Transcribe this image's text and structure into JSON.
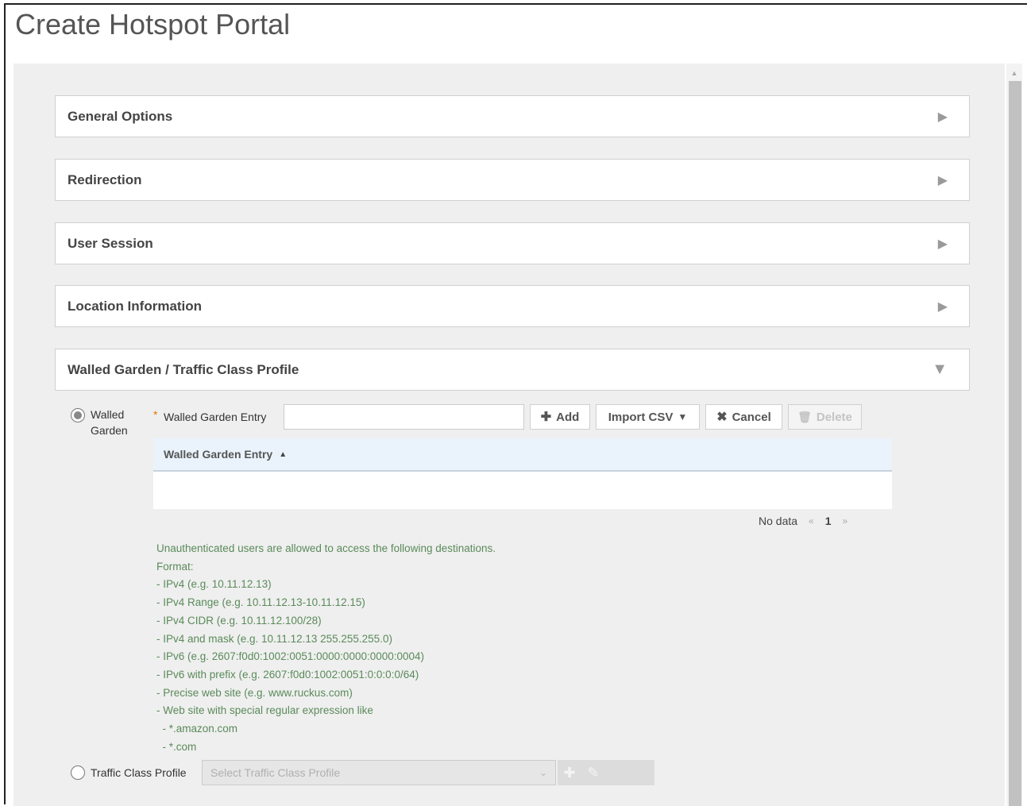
{
  "page": {
    "title": "Create Hotspot Portal"
  },
  "panels": [
    {
      "label": "General Options",
      "expanded": false
    },
    {
      "label": "Redirection",
      "expanded": false
    },
    {
      "label": "User Session",
      "expanded": false
    },
    {
      "label": "Location Information",
      "expanded": false
    },
    {
      "label": "Walled Garden / Traffic Class Profile",
      "expanded": true
    }
  ],
  "walled_garden": {
    "radio_label_line1": "Walled",
    "radio_label_line2": "Garden",
    "selected": true,
    "required_marker": "*",
    "entry_label": "Walled Garden Entry",
    "entry_value": "",
    "buttons": {
      "add": "Add",
      "import_csv": "Import CSV",
      "cancel": "Cancel",
      "delete": "Delete"
    },
    "table": {
      "column_header": "Walled Garden Entry",
      "rows": []
    },
    "pager": {
      "status": "No data",
      "prev": "«",
      "current_page": "1",
      "next": "»"
    },
    "help_lines": [
      "Unauthenticated users are allowed to access the following destinations.",
      "Format:",
      "- IPv4 (e.g. 10.11.12.13)",
      "- IPv4 Range (e.g. 10.11.12.13-10.11.12.15)",
      "- IPv4 CIDR (e.g. 10.11.12.100/28)",
      "- IPv4 and mask (e.g. 10.11.12.13 255.255.255.0)",
      "- IPv6 (e.g. 2607:f0d0:1002:0051:0000:0000:0000:0004)",
      "- IPv6 with prefix (e.g. 2607:f0d0:1002:0051:0:0:0:0/64)",
      "- Precise web site (e.g. www.ruckus.com)",
      "- Web site with special regular expression like",
      "  - *.amazon.com",
      "  - *.com"
    ]
  },
  "traffic_class": {
    "radio_label": "Traffic Class Profile",
    "selected": false,
    "select_placeholder": "Select Traffic Class Profile"
  },
  "colors": {
    "help_text": "#5a8a5a",
    "required_star": "#e07b00",
    "table_header_bg": "#eaf3fb"
  }
}
